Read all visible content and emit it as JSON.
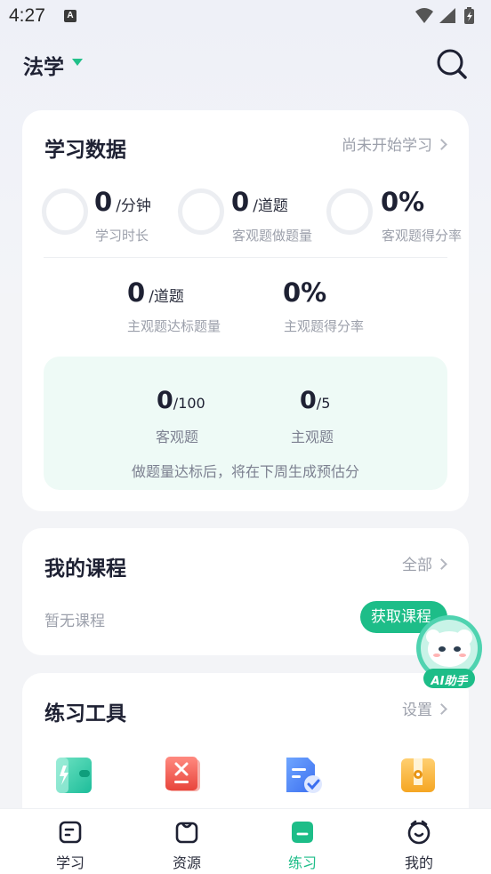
{
  "status_bar": {
    "time": "4:27",
    "notification_letter": "A"
  },
  "header": {
    "subject": "法学"
  },
  "study_data": {
    "title": "学习数据",
    "status_link": "尚未开始学习",
    "stats_row1": [
      {
        "value": "0",
        "unit": "/分钟",
        "label": "学习时长"
      },
      {
        "value": "0",
        "unit": "/道题",
        "label": "客观题做题量"
      },
      {
        "value": "0%",
        "unit": "",
        "label": "客观题得分率"
      }
    ],
    "stats_row2": [
      {
        "value": "0",
        "unit": "/道题",
        "label": "主观题达标题量"
      },
      {
        "value": "0%",
        "unit": "",
        "label": "主观题得分率"
      }
    ],
    "progress": {
      "objective": {
        "value": "0",
        "target": "/100",
        "label": "客观题"
      },
      "subjective": {
        "value": "0",
        "target": "/5",
        "label": "主观题"
      },
      "note": "做题量达标后，将在下周生成预估分"
    }
  },
  "courses": {
    "title": "我的课程",
    "link": "全部",
    "empty_text": "暂无课程",
    "button": "获取课程"
  },
  "tools": {
    "title": "练习工具",
    "link": "设置",
    "icons": [
      "flash-card-icon",
      "wrong-book-icon",
      "exam-paper-icon",
      "file-bag-icon"
    ]
  },
  "ai_assistant": {
    "label": "AI助手"
  },
  "nav": [
    {
      "label": "学习",
      "icon": "study-icon",
      "active": false
    },
    {
      "label": "资源",
      "icon": "resource-icon",
      "active": false
    },
    {
      "label": "练习",
      "icon": "practice-icon",
      "active": true
    },
    {
      "label": "我的",
      "icon": "profile-icon",
      "active": false
    }
  ],
  "colors": {
    "accent": "#1dbd88",
    "mint": "#eefaf6",
    "text": "#1e2133",
    "muted": "#9ca0ab"
  }
}
